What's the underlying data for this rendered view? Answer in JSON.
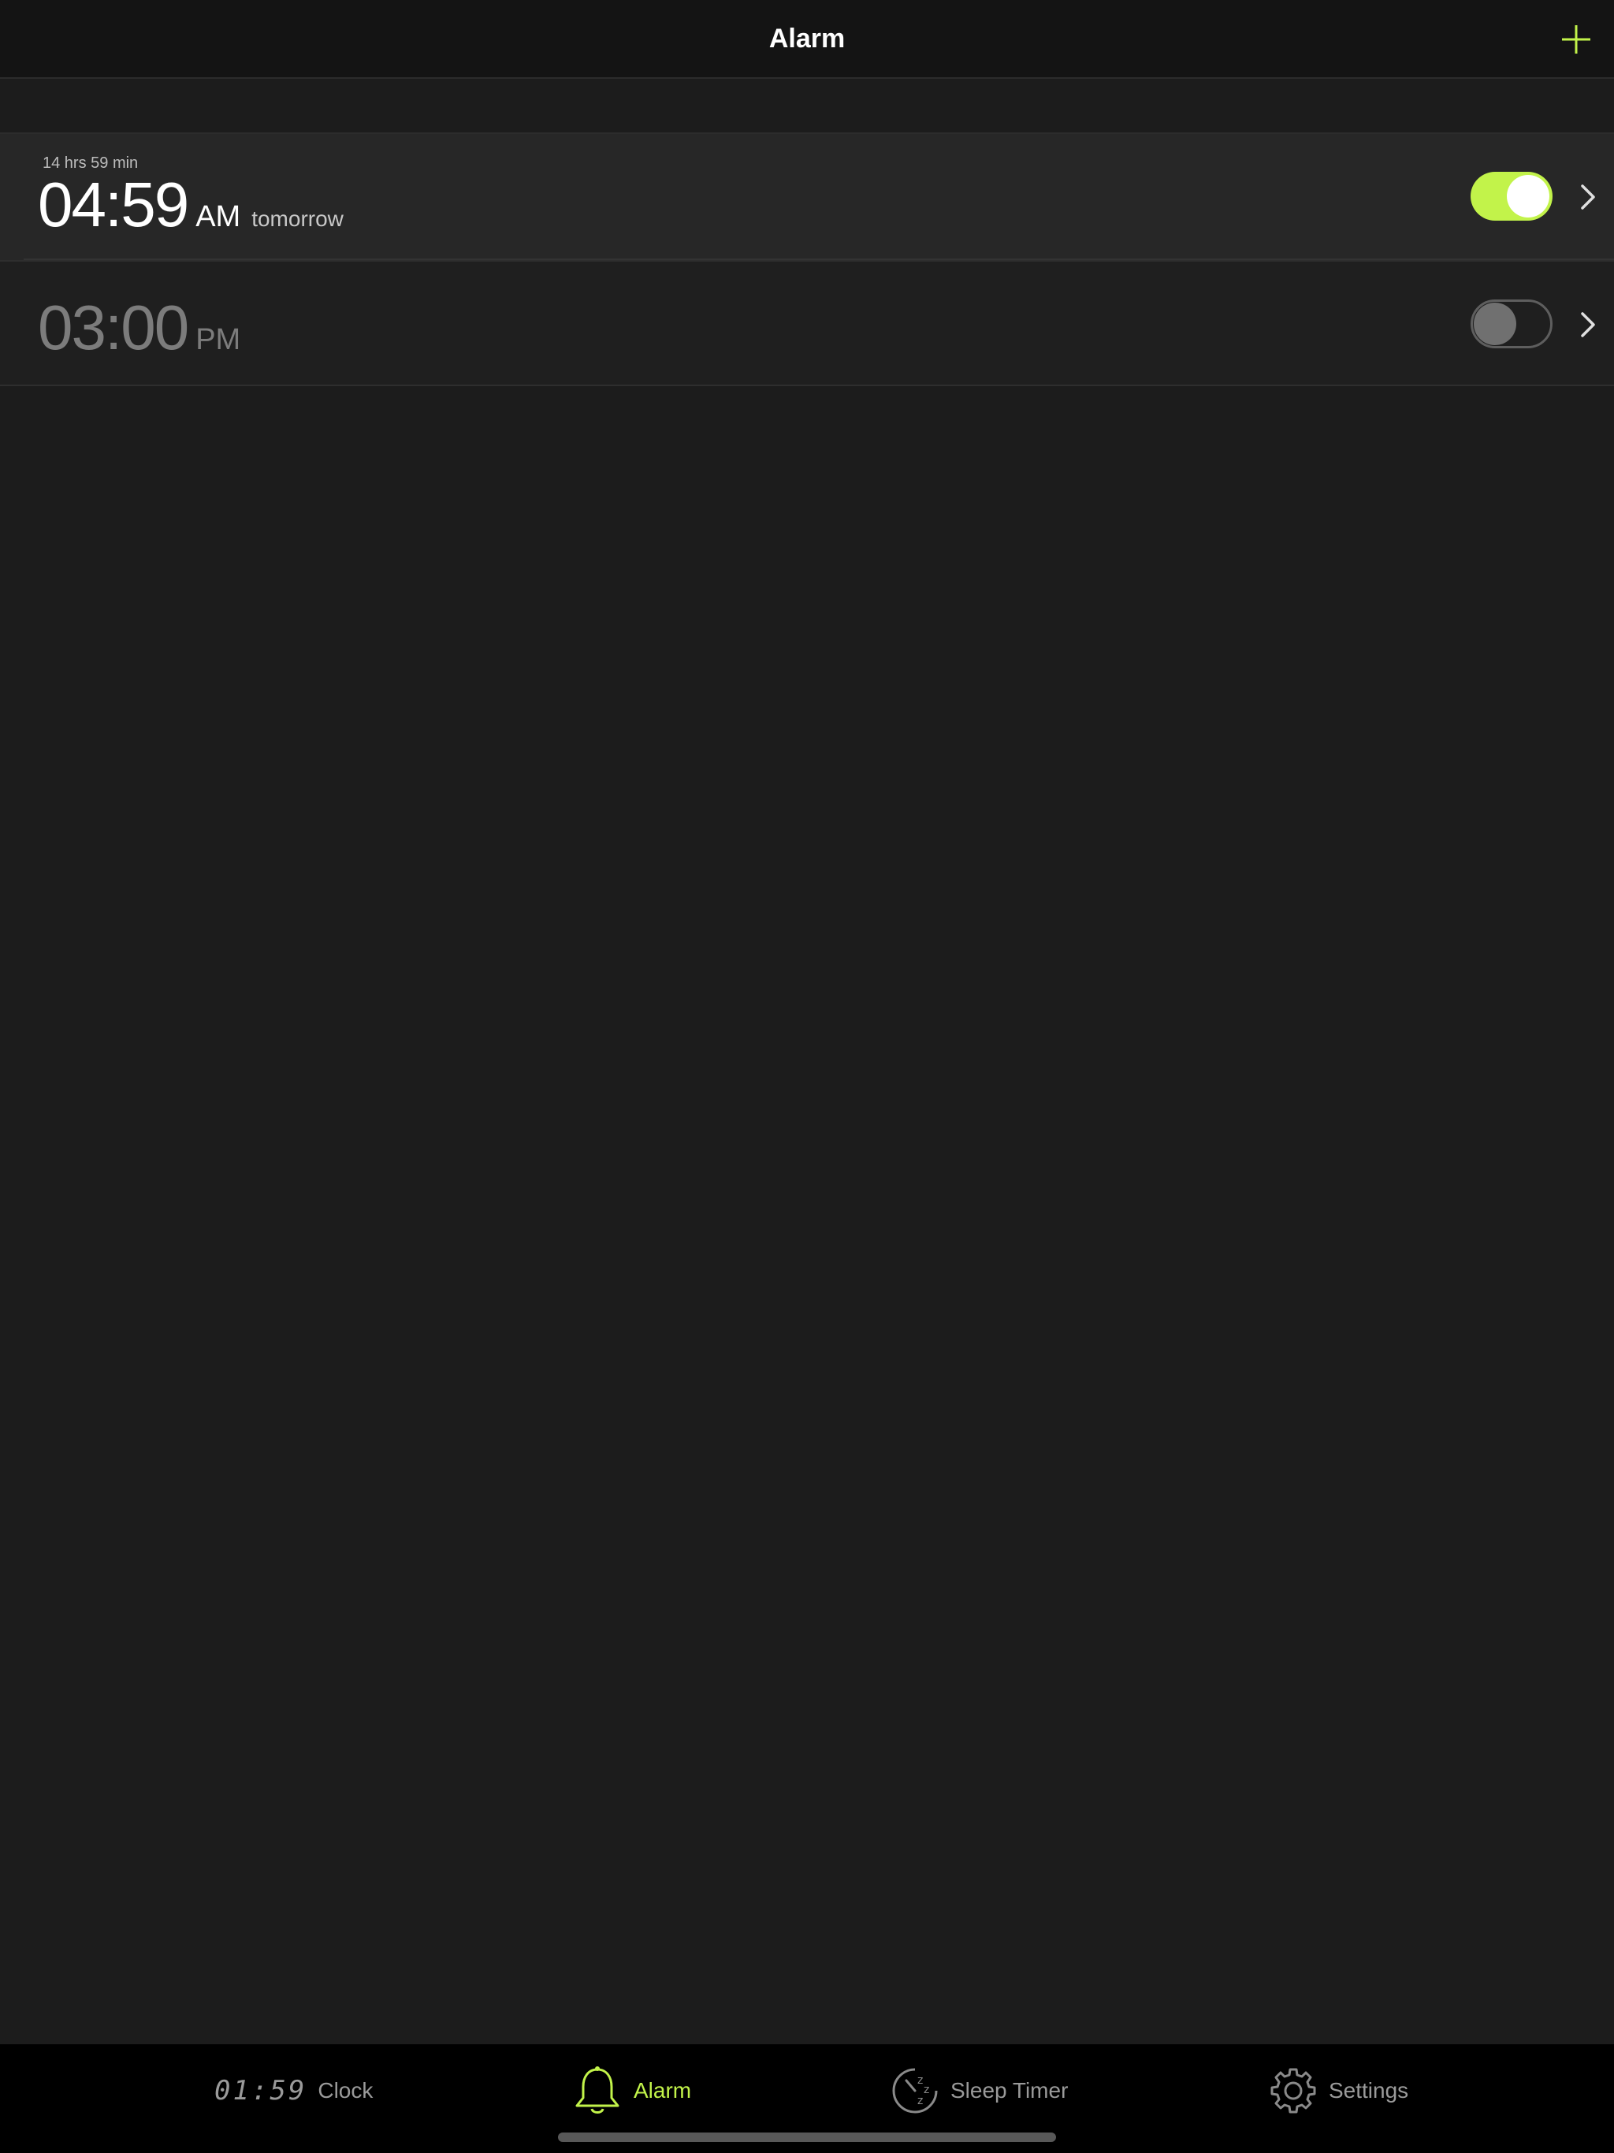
{
  "header": {
    "title": "Alarm",
    "add_icon": "plus-icon",
    "accent_color": "#c2f34a"
  },
  "alarms": [
    {
      "countdown": "14 hrs 59 min",
      "time": "04:59",
      "ampm": "AM",
      "when": "tomorrow",
      "enabled": true
    },
    {
      "countdown": "",
      "time": "03:00",
      "ampm": "PM",
      "when": "",
      "enabled": false
    }
  ],
  "tabbar": {
    "clock": {
      "display": "01:59",
      "label": "Clock"
    },
    "alarm": {
      "label": "Alarm",
      "icon": "bell-icon",
      "active": true
    },
    "sleep": {
      "label": "Sleep Timer",
      "icon": "sleep-timer-icon"
    },
    "settings": {
      "label": "Settings",
      "icon": "gear-icon"
    }
  }
}
